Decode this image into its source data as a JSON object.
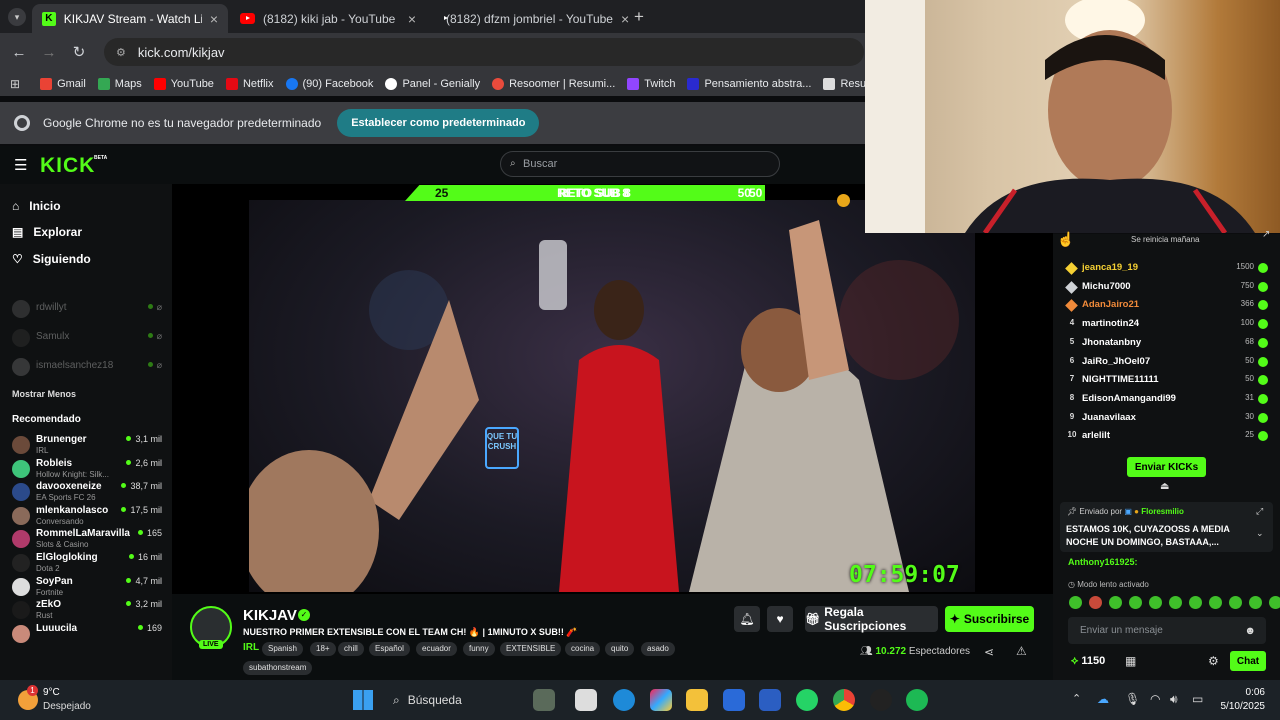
{
  "browser": {
    "tabs": [
      {
        "label": "KIKJAV Stream - Watch Live on",
        "close": "×"
      },
      {
        "label": "(8182) kiki jab - YouTube",
        "close": "×"
      },
      {
        "label": "(8182) dfzm jombriel - YouTube",
        "close": "×"
      }
    ],
    "new_tab": "+",
    "url": "kick.com/kikjav",
    "bookmarks": [
      {
        "label": "Gmail",
        "color": "#ea4335"
      },
      {
        "label": "Maps",
        "color": "#34a853"
      },
      {
        "label": "YouTube",
        "color": "#ff0000"
      },
      {
        "label": "Netflix",
        "color": "#e50914"
      },
      {
        "label": "(90) Facebook",
        "color": "#1877f2"
      },
      {
        "label": "Panel - Genially",
        "color": "#ffffff"
      },
      {
        "label": "Resoomer | Resumi...",
        "color": "#e94b3c"
      },
      {
        "label": "Twitch",
        "color": "#9146ff"
      },
      {
        "label": "Pensamiento abstra...",
        "color": "#2a2ad0"
      },
      {
        "label": "Resumid",
        "color": "#dddddd"
      }
    ],
    "default_banner": "Google Chrome no es tu navegador predeterminado",
    "default_button": "Establecer como predeterminado"
  },
  "kick": {
    "logo": "KICK",
    "logo_beta": "BETA",
    "search_placeholder": "Buscar",
    "nav": [
      "Inicio",
      "Explorar",
      "Siguiendo"
    ],
    "following_offline": [
      "rdwillyt",
      "Samulx",
      "ismaelsanchez18"
    ],
    "show_less": "Mostrar Menos",
    "recommended_title": "Recomendado",
    "recommended": [
      {
        "name": "Brunenger",
        "cat": "IRL",
        "viewers": "3,1 mil",
        "color": "#6b4a3a"
      },
      {
        "name": "Robleis",
        "cat": "Hollow Knight: Silk...",
        "viewers": "2,6 mil",
        "color": "#3ec47a"
      },
      {
        "name": "davooxeneize",
        "cat": "EA Sports FC 26",
        "viewers": "38,7 mil",
        "color": "#2b4a8a"
      },
      {
        "name": "mlenkanolasco",
        "cat": "Conversando",
        "viewers": "17,5 mil",
        "color": "#8a6a5a"
      },
      {
        "name": "RommelLaMaravilla",
        "cat": "Slots & Casino",
        "viewers": "165",
        "color": "#b03a6a"
      },
      {
        "name": "ElGlogloking",
        "cat": "Dota 2",
        "viewers": "16 mil",
        "color": "#222"
      },
      {
        "name": "SoyPan",
        "cat": "Fortnite",
        "viewers": "4,7 mil",
        "color": "#ddd"
      },
      {
        "name": "zEkO",
        "cat": "Rust",
        "viewers": "3,2 mil",
        "color": "#1a1a1a"
      },
      {
        "name": "Luuucila",
        "cat": "",
        "viewers": "169",
        "color": "#c98a7a"
      }
    ]
  },
  "player": {
    "goal_left": "25",
    "goal_label": "RETO SUB 8",
    "goal_right": "50",
    "goal_fraction": 0.5,
    "timer": "07:59:07",
    "neon_sign": "QUE TU CRUSH"
  },
  "channel": {
    "name": "KIKJAV",
    "live": "LIVE",
    "title": "NUESTRO PRIMER EXTENSIBLE CON EL TEAM CH! 🔥 | 1MINUTO X SUB!! 🧨",
    "category": "IRL",
    "tags": [
      "Spanish",
      "18+",
      "chill",
      "Español",
      "ecuador",
      "funny",
      "EXTENSIBLE",
      "cocina",
      "quito",
      "asado",
      "subathonstream"
    ],
    "gift_button": "Regala Suscripciones",
    "subscribe_button": "Suscribirse",
    "viewers_count": "10.272",
    "viewers_label": "Espectadores"
  },
  "chat": {
    "reset_note": "Se reinicia mañana",
    "leaderboard": [
      {
        "rank": "",
        "name": "jeanca19_19",
        "pts": "1500",
        "color": "#f5d033"
      },
      {
        "rank": "",
        "name": "Michu7000",
        "pts": "750",
        "color": "#ffffff"
      },
      {
        "rank": "",
        "name": "AdanJairo21",
        "pts": "366",
        "color": "#f08a3a"
      },
      {
        "rank": "4",
        "name": "martinotin24",
        "pts": "100",
        "color": "#ffffff"
      },
      {
        "rank": "5",
        "name": "Jhonatanbny",
        "pts": "68",
        "color": "#ffffff"
      },
      {
        "rank": "6",
        "name": "JaiRo_JhOel07",
        "pts": "50",
        "color": "#ffffff"
      },
      {
        "rank": "7",
        "name": "NIGHTTIME11111",
        "pts": "50",
        "color": "#ffffff"
      },
      {
        "rank": "8",
        "name": "EdisonAmangandi99",
        "pts": "31",
        "color": "#ffffff"
      },
      {
        "rank": "9",
        "name": "Juanavilaax",
        "pts": "30",
        "color": "#ffffff"
      },
      {
        "rank": "10",
        "name": "arlelilt",
        "pts": "25",
        "color": "#ffffff"
      }
    ],
    "send_kicks": "Enviar KICKs",
    "pinned_by": "Enviado por",
    "pinned_user": "Floresmilio",
    "pinned_msg": "ESTAMOS 10K, CUYAZOOSS A MEDIA NOCHE UN DOMINGO, BASTAAA,...",
    "chat_user": "Anthony161925:",
    "slow_mode": "Modo lento activado",
    "input_placeholder": "Enviar un mensaje",
    "points": "1150",
    "chat_button": "Chat"
  },
  "taskbar": {
    "weather_temp": "9°C",
    "weather_desc": "Despejado",
    "search_label": "Búsqueda",
    "time": "0:06",
    "date": "5/10/2025"
  }
}
